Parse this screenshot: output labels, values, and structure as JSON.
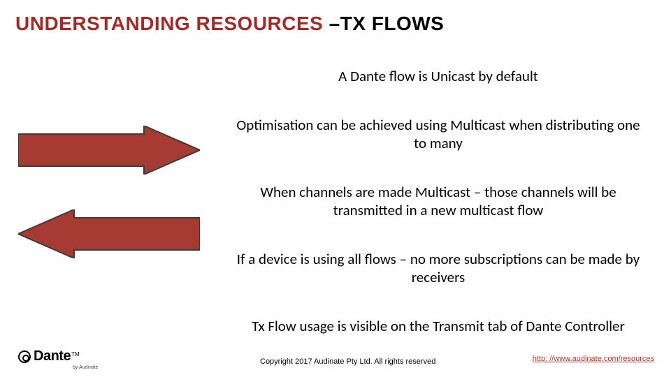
{
  "title": {
    "red_part": "UNDERSTANDING RESOURCES ",
    "black_part": " –TX FLOWS"
  },
  "bullets": [
    "A Dante flow is Unicast by default",
    "Optimisation can be achieved using Multicast when distributing one to many",
    "When channels are made Multicast – those channels will be transmitted in a new multicast flow",
    "If a device is using all flows – no more subscriptions can be made by receivers",
    "Tx Flow usage is visible on the Transmit tab of Dante Controller"
  ],
  "arrows": {
    "fill": "#a73a33",
    "stroke": "#3b3b3b"
  },
  "footer": {
    "logo_text": "Dante",
    "logo_tm": "TM",
    "logo_sub": "by Audinate",
    "copyright": "Copyright 2017 Audinate Pty Ltd. All rights reserved",
    "link_text": "http: //www.audinate.com/resources",
    "link_href": "http://www.audinate.com/resources"
  }
}
